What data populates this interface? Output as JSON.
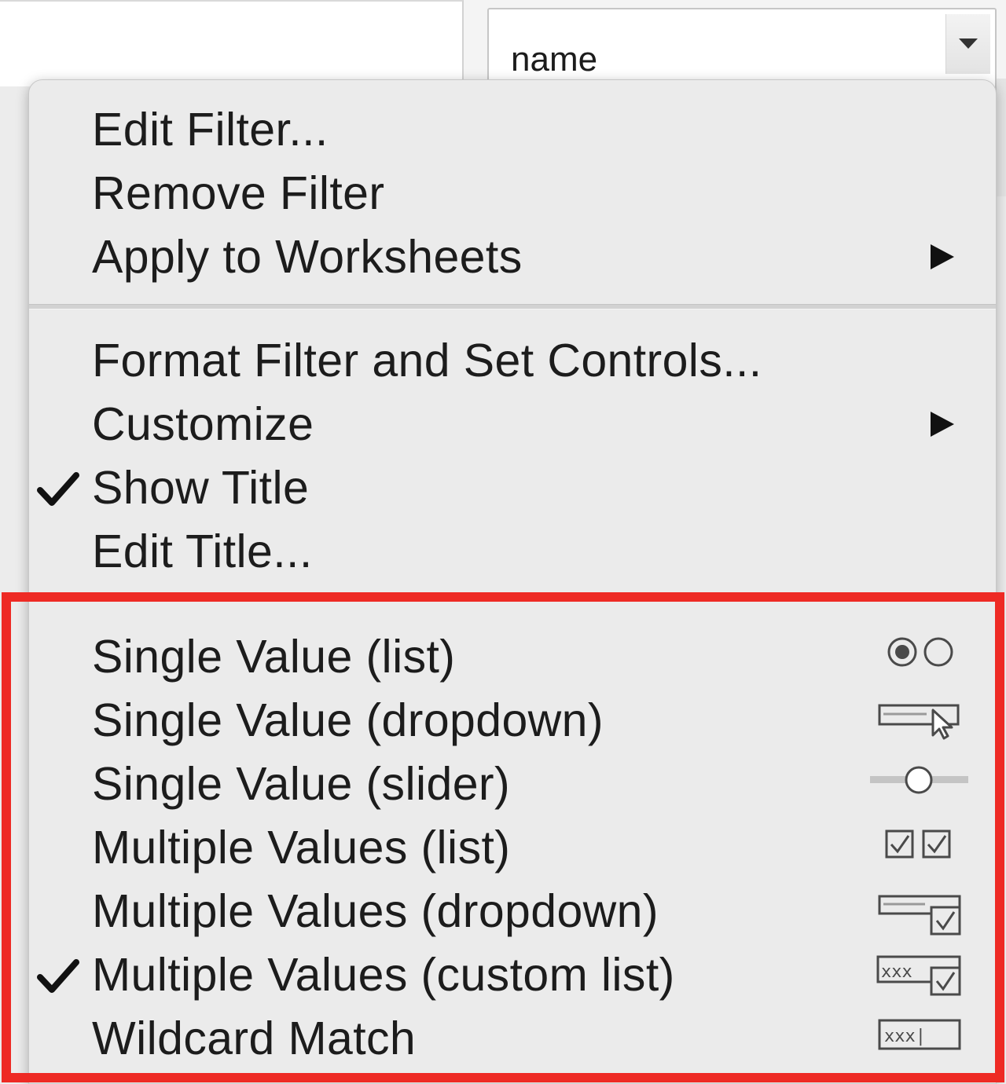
{
  "filter_control": {
    "selected_value": "name"
  },
  "menu": {
    "items": [
      {
        "label": "Edit Filter...",
        "checked": false,
        "has_submenu": false
      },
      {
        "label": "Remove Filter",
        "checked": false,
        "has_submenu": false
      },
      {
        "label": "Apply to Worksheets",
        "checked": false,
        "has_submenu": true
      },
      {
        "label": "Format Filter and Set Controls...",
        "checked": false,
        "has_submenu": false
      },
      {
        "label": "Customize",
        "checked": false,
        "has_submenu": true
      },
      {
        "label": "Show Title",
        "checked": true,
        "has_submenu": false
      },
      {
        "label": "Edit Title...",
        "checked": false,
        "has_submenu": false
      }
    ],
    "filter_modes": [
      {
        "label": "Single Value (list)",
        "checked": false,
        "icon": "radio-buttons-icon"
      },
      {
        "label": "Single Value (dropdown)",
        "checked": false,
        "icon": "dropdown-cursor-icon"
      },
      {
        "label": "Single Value (slider)",
        "checked": false,
        "icon": "slider-icon"
      },
      {
        "label": "Multiple Values (list)",
        "checked": false,
        "icon": "checkboxes-icon"
      },
      {
        "label": "Multiple Values (dropdown)",
        "checked": false,
        "icon": "dropdown-checkbox-icon"
      },
      {
        "label": "Multiple Values (custom list)",
        "checked": true,
        "icon": "custom-list-icon"
      },
      {
        "label": "Wildcard Match",
        "checked": false,
        "icon": "wildcard-field-icon"
      }
    ],
    "icon_text": {
      "custom_list": "xxx",
      "wildcard": "xxx|"
    }
  },
  "colors": {
    "menu_background": "#ebebeb",
    "highlight_border": "#ee2a24",
    "text": "#1c1c1c",
    "icon_stroke": "#4a4a4a"
  }
}
